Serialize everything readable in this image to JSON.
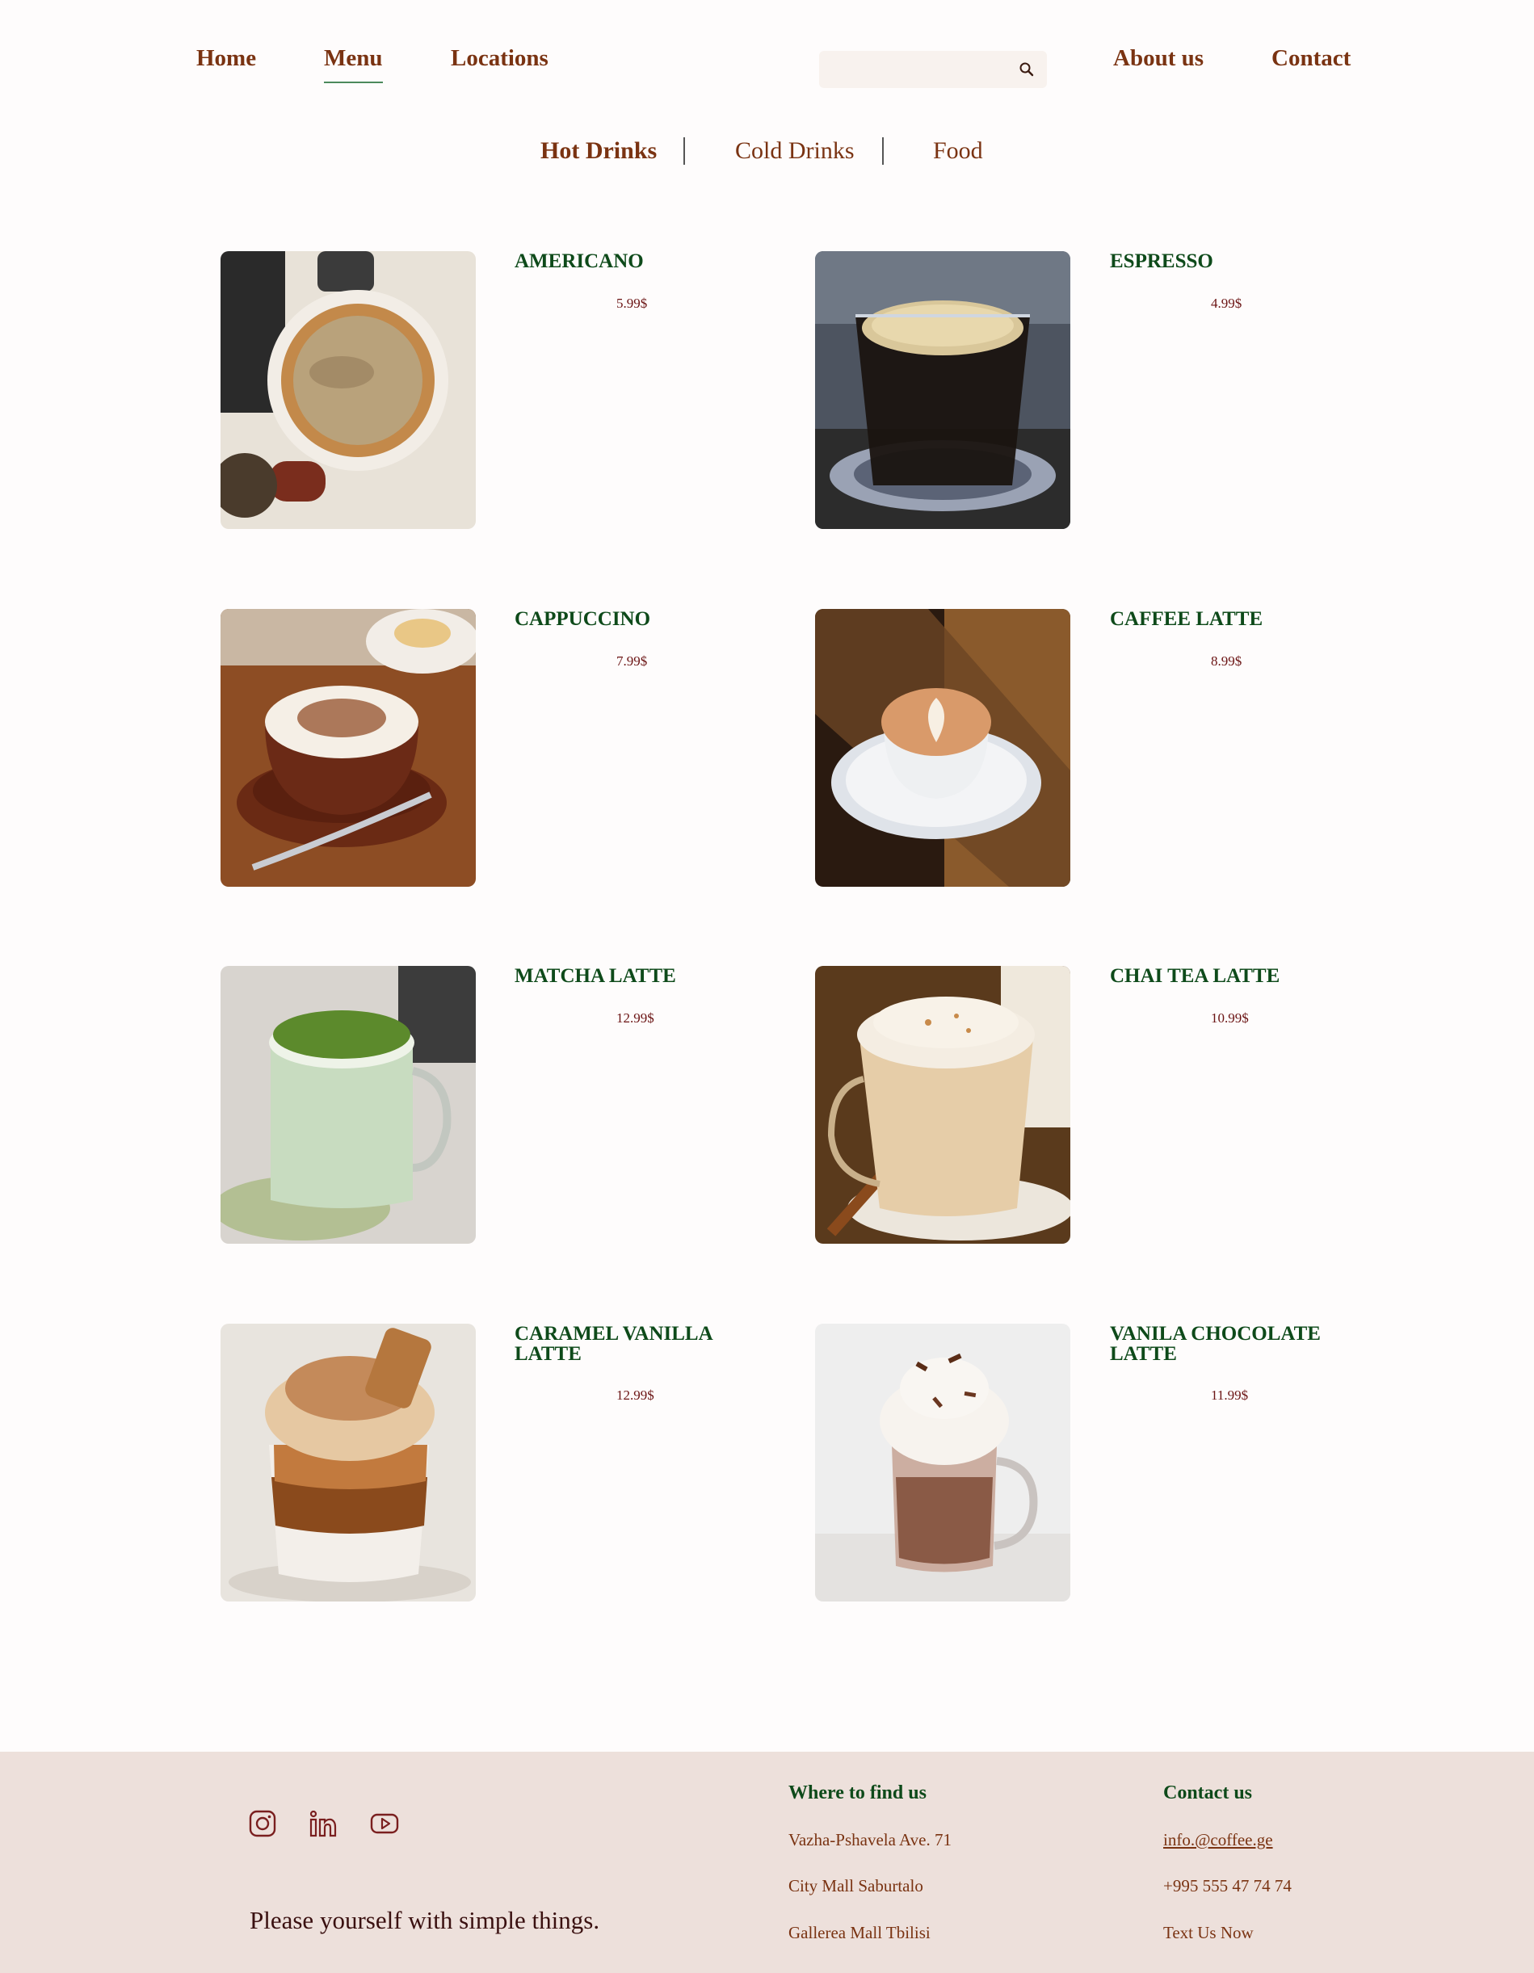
{
  "nav": {
    "home": "Home",
    "menu": "Menu",
    "locations": "Locations",
    "about": "About us",
    "contact": "Contact"
  },
  "search": {
    "placeholder": "",
    "value": ""
  },
  "tabs": {
    "hot": "Hot Drinks",
    "cold": "Cold Drinks",
    "food": "Food",
    "active": "Hot Drinks"
  },
  "menu_items": [
    {
      "name": "AMERICANO",
      "price": "5.99$"
    },
    {
      "name": "ESPRESSO",
      "price": "4.99$"
    },
    {
      "name": "CAPPUCCINO",
      "price": "7.99$"
    },
    {
      "name": "CAFFEE LATTE",
      "price": "8.99$"
    },
    {
      "name": "MATCHA LATTE",
      "price": "12.99$"
    },
    {
      "name": "CHAI TEA LATTE",
      "price": "10.99$"
    },
    {
      "name": "CARAMEL VANILLA LATTE",
      "price": "12.99$"
    },
    {
      "name": "VANILA CHOCOLATE LATTE",
      "price": "11.99$"
    }
  ],
  "footer": {
    "social_icons": [
      "instagram-icon",
      "linkedin-icon",
      "youtube-icon"
    ],
    "tagline": "Please yourself with simple things.",
    "where_heading": "Where to find us",
    "locations": [
      "Vazha-Pshavela Ave. 71",
      "City Mall Saburtalo",
      "Gallerea Mall Tbilisi"
    ],
    "contact_heading": "Contact us",
    "email": "info.@coffee.ge",
    "phone": "+995 555 47 74 74",
    "text_us": "Text Us Now"
  },
  "colors": {
    "brand_brown": "#7a3312",
    "heading_green": "#0e4a1a",
    "price_red": "#6b1414",
    "footer_bg": "#ede0db",
    "active_underline": "#4c8a5c"
  }
}
